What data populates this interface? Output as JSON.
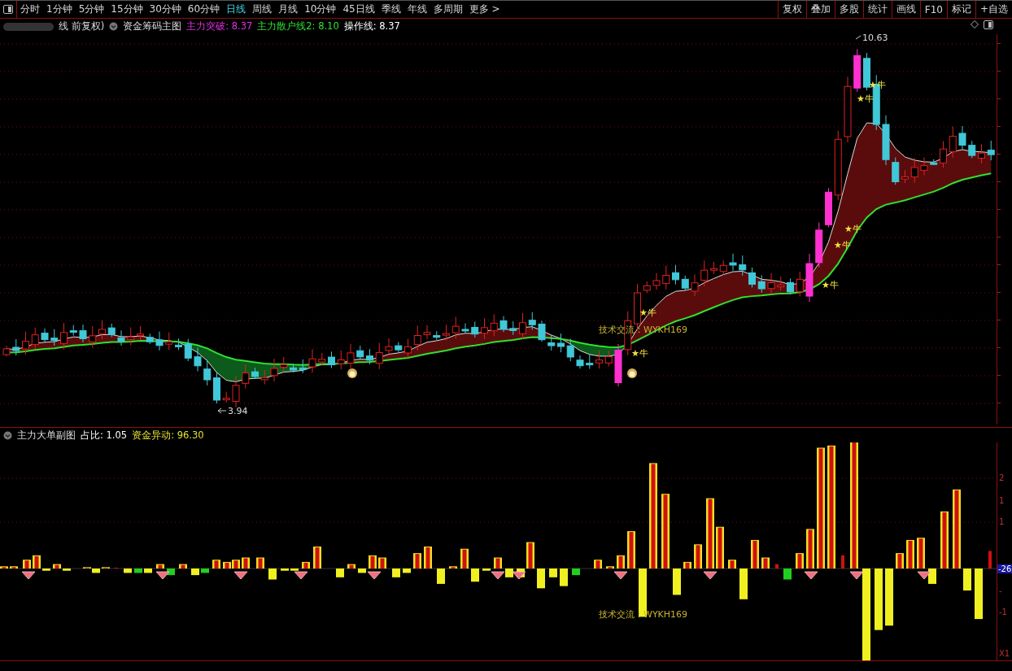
{
  "toolbar": {
    "periods": [
      {
        "label": "分时",
        "selected": false
      },
      {
        "label": "1分钟",
        "selected": false
      },
      {
        "label": "5分钟",
        "selected": false
      },
      {
        "label": "15分钟",
        "selected": false
      },
      {
        "label": "30分钟",
        "selected": false
      },
      {
        "label": "60分钟",
        "selected": false
      },
      {
        "label": "日线",
        "selected": true
      },
      {
        "label": "周线",
        "selected": false
      },
      {
        "label": "月线",
        "selected": false
      },
      {
        "label": "10分钟",
        "selected": false
      },
      {
        "label": "45日线",
        "selected": false
      },
      {
        "label": "季线",
        "selected": false
      },
      {
        "label": "年线",
        "selected": false
      },
      {
        "label": "多周期",
        "selected": false
      }
    ],
    "more": "更多 >",
    "buttons": [
      "复权",
      "叠加",
      "多股",
      "统计",
      "画线",
      "F10",
      "标记",
      "+自选"
    ]
  },
  "main_chart": {
    "title": "线 前复权)",
    "indicator": "资金筹码主图",
    "values": [
      {
        "label": "主力突破: 8.37",
        "color": "#e030e0"
      },
      {
        "label": "主力散户线2: 8.10",
        "color": "#30e030"
      },
      {
        "label": "操作线: 8.37",
        "color": "#ffffff"
      }
    ],
    "high_label": "10.63",
    "low_label": "3.94",
    "signals": [
      "★牛",
      "★牛",
      "★牛",
      "★牛",
      "★牛",
      "★牛",
      "★牛"
    ],
    "notice": "技术交流：WYKH169"
  },
  "sub_chart": {
    "indicator": "主力大单副图",
    "values": [
      {
        "label": "占比: 1.05",
        "color": "#ffffff"
      },
      {
        "label": "资金异动: 96.30",
        "color": "#e0e030"
      }
    ],
    "notice": "技术交流：WYKH169",
    "axis_labels": [
      "2",
      "1",
      "1",
      "-",
      "-1"
    ],
    "current": "-26",
    "scale": "X1"
  }
}
